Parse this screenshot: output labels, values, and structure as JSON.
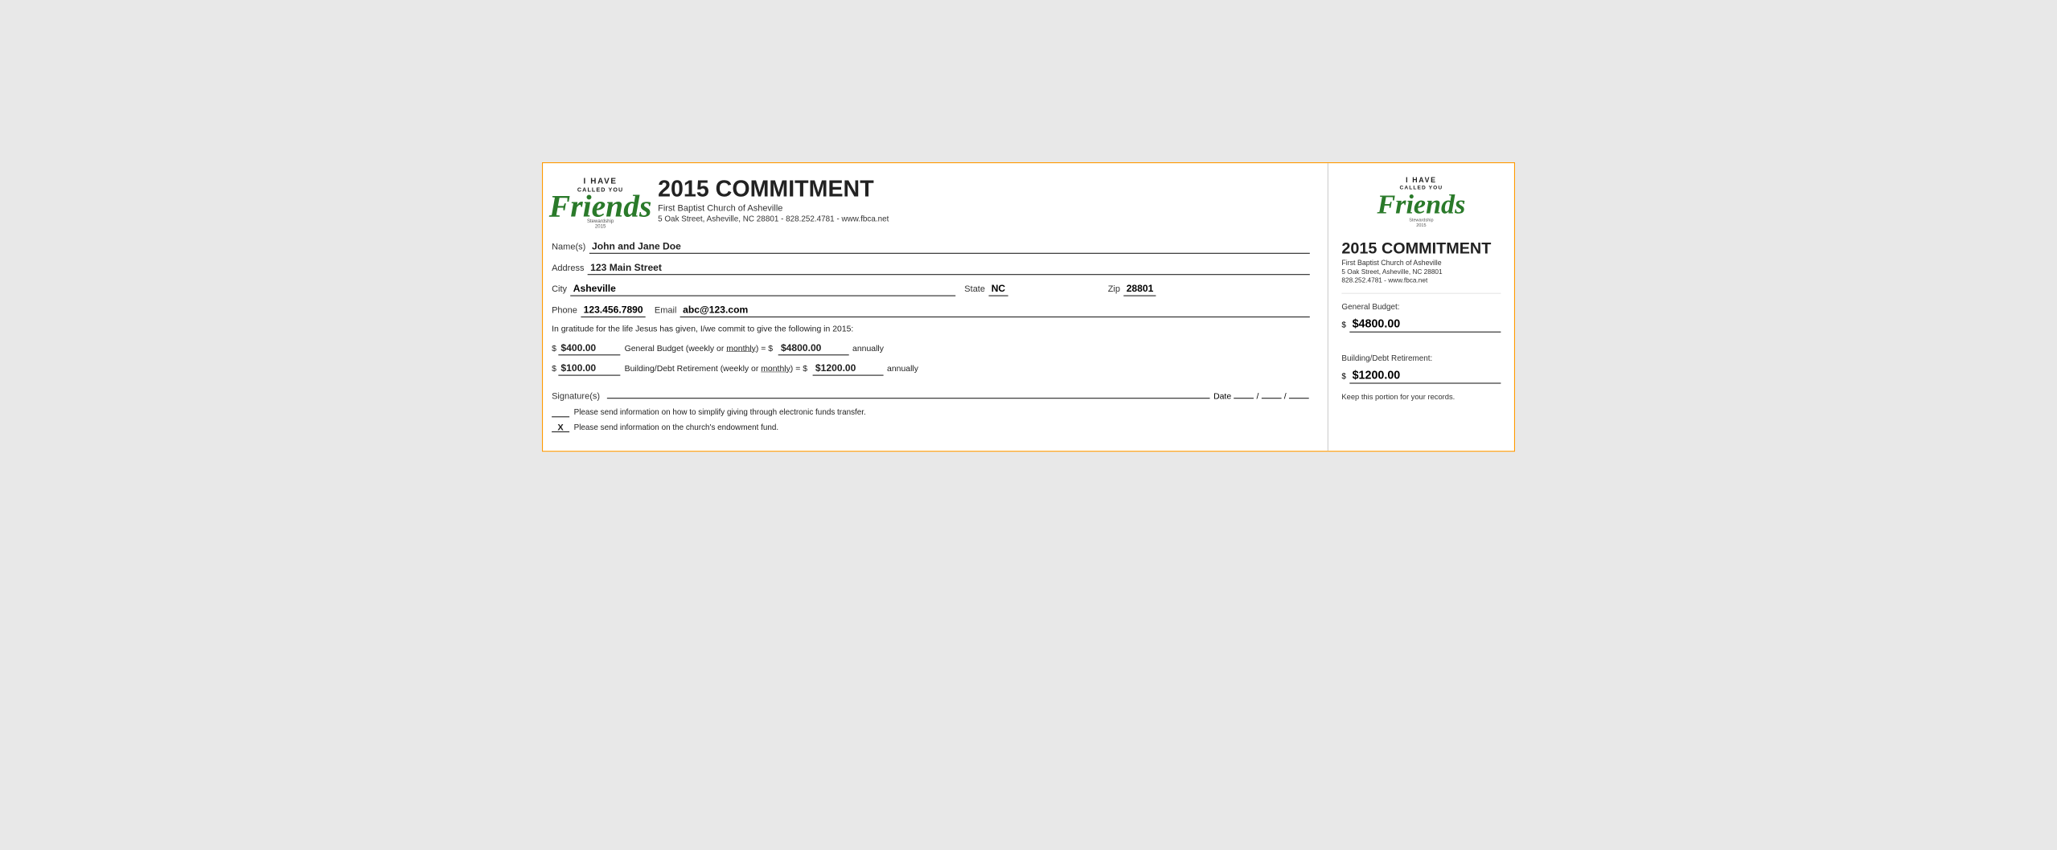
{
  "left": {
    "logo": {
      "i_have": "I HAVE",
      "called_you": "CALLED YOU",
      "friends": "Friends",
      "stewardship": "Stewardship\n2015"
    },
    "title": "2015 COMMITMENT",
    "church_name": "First Baptist Church of Asheville",
    "church_address": "5 Oak Street, Asheville, NC  28801 - 828.252.4781 - www.fbca.net",
    "fields": {
      "names_label": "Name(s)",
      "names_value": "John and Jane Doe",
      "address_label": "Address",
      "address_value": "123 Main Street",
      "city_label": "City",
      "city_value": "Asheville",
      "state_label": "State",
      "state_value": "NC",
      "zip_label": "Zip",
      "zip_value": "28801",
      "phone_label": "Phone",
      "phone_value": "123.456.7890",
      "email_label": "Email",
      "email_value": "abc@123.com"
    },
    "commitment_text": "In gratitude for the life Jesus has given, I/we commit to give the following in 2015:",
    "giving": {
      "row1": {
        "amount": "$400.00",
        "desc_before": "General Budget (weekly or",
        "monthly": "monthly",
        "desc_after": ") = $",
        "annual": "$4800.00",
        "annually": "annually"
      },
      "row2": {
        "amount": "$100.00",
        "desc_before": "Building/Debt Retirement (weekly or",
        "monthly": "monthly",
        "desc_after": ") = $",
        "annual": "$1200.00",
        "annually": "annually"
      }
    },
    "signature_label": "Signature(s)",
    "date_label": "Date",
    "checkbox1_text": "Please send information on how to simplify giving through electronic funds transfer.",
    "checkbox1_checked": false,
    "checkbox2_text": "Please send information on the church's endowment fund.",
    "checkbox2_checked": true,
    "checkbox2_mark": "X"
  },
  "right": {
    "logo": {
      "i_have": "I HAVE",
      "called_you": "CALLED YOU",
      "friends": "Friends",
      "stewardship": "Stewardship\n2015"
    },
    "title": "2015 COMMITMENT",
    "church_name": "First Baptist Church of Asheville",
    "church_address1": "5 Oak Street, Asheville, NC  28801",
    "church_address2": "828.252.4781 - www.fbca.net",
    "general_budget_label": "General Budget:",
    "general_budget_amount": "$4800.00",
    "building_label": "Building/Debt Retirement:",
    "building_amount": "$1200.00",
    "keep_text": "Keep this portion for your records."
  }
}
